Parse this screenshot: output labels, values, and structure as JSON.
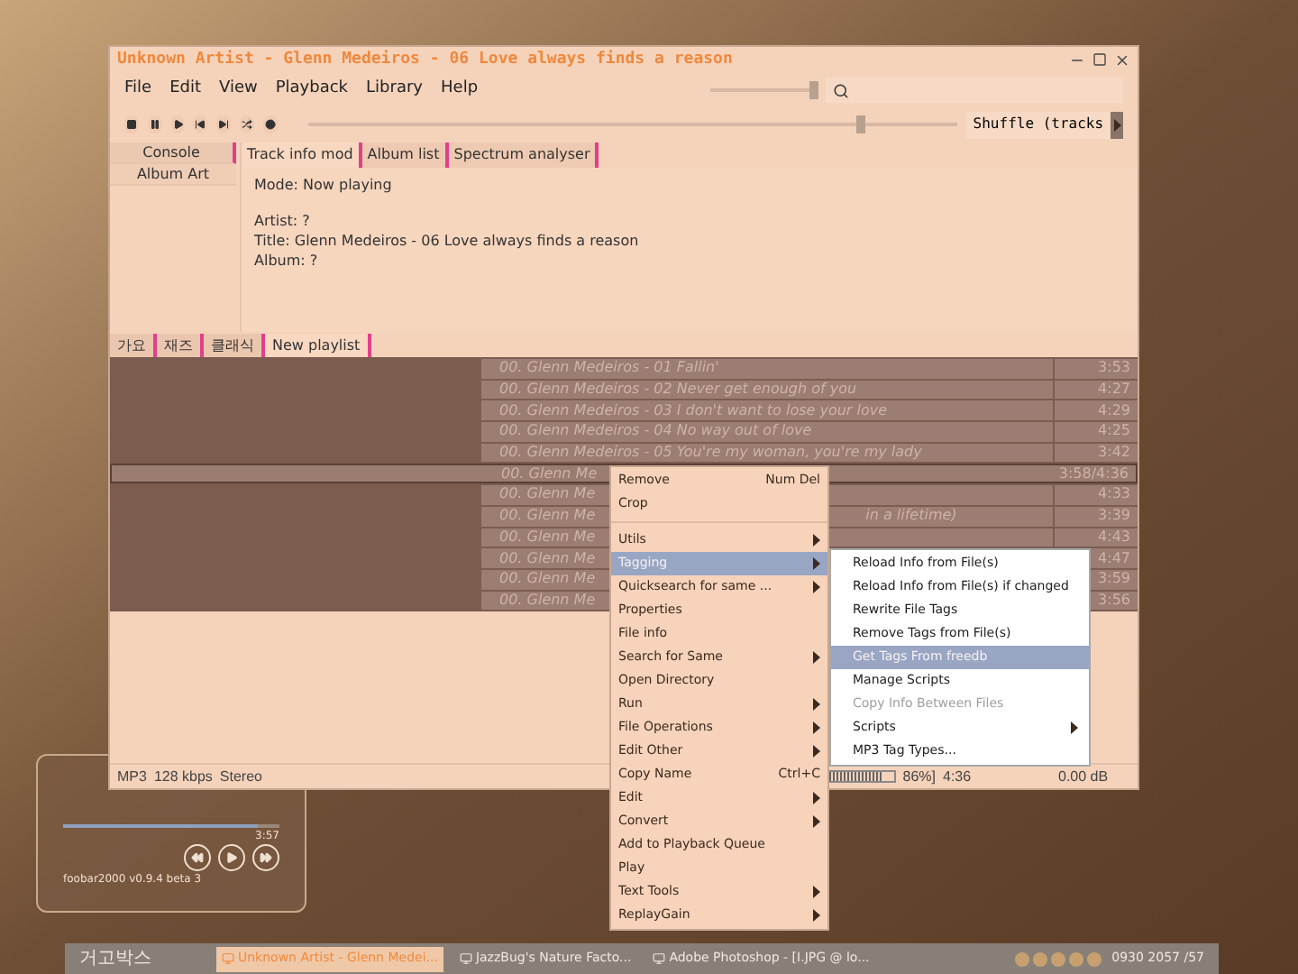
{
  "window": {
    "title": "Unknown Artist - Glenn Medeiros - 06 Love always finds a reason",
    "menu": [
      {
        "label": "File"
      },
      {
        "label": "Edit"
      },
      {
        "label": "View"
      },
      {
        "label": "Playback"
      },
      {
        "label": "Library"
      },
      {
        "label": "Help"
      }
    ],
    "volume": {
      "level": 1
    },
    "seek": {
      "level": 0.86
    },
    "order_dropdown": {
      "value": "Shuffle (tracks"
    },
    "side_tabs": [
      {
        "label": "Console",
        "selected": true
      },
      {
        "label": "Album Art",
        "selected": false
      }
    ],
    "panel_tabs": [
      {
        "label": "Track info mod",
        "selected": true
      },
      {
        "label": "Album list",
        "selected": false
      },
      {
        "label": "Spectrum analyser",
        "selected": false
      }
    ],
    "track_info": [
      [
        "Mode: Now playing"
      ],
      [
        "Artist: ?",
        "Title: Glenn Medeiros - 06 Love always finds a reason",
        "Album: ?"
      ]
    ],
    "playlist_tabs": [
      {
        "label": "가요",
        "selected": false
      },
      {
        "label": "재즈",
        "selected": false
      },
      {
        "label": "클래식",
        "selected": false
      },
      {
        "label": "New playlist",
        "selected": true
      }
    ],
    "tracks": [
      {
        "title": "00. Glenn Medeiros - 01 Fallin'",
        "time": "3:53",
        "playing": false
      },
      {
        "title": "00. Glenn Medeiros - 02 Never get enough of you",
        "time": "4:27",
        "playing": false
      },
      {
        "title": "00. Glenn Medeiros - 03 I don't want to lose your love",
        "time": "4:29",
        "playing": false
      },
      {
        "title": "00. Glenn Medeiros - 04 No way out of love",
        "time": "4:25",
        "playing": false
      },
      {
        "title": "00. Glenn Medeiros - 05 You're my woman, you're my lady",
        "time": "3:42",
        "playing": false
      },
      {
        "title": "00. Glenn Me",
        "time": "3:58/4:36",
        "playing": true
      },
      {
        "title": "00. Glenn Me",
        "time": "4:33",
        "playing": false
      },
      {
        "title": "00. Glenn Me",
        "title_tail": "in a lifetime)",
        "time": "3:39",
        "playing": false
      },
      {
        "title": "00. Glenn Me",
        "time": "4:43",
        "playing": false
      },
      {
        "title": "00. Glenn Me",
        "time": "4:47",
        "playing": false
      },
      {
        "title": "00. Glenn Me",
        "time": "3:59",
        "playing": false
      },
      {
        "title": "00. Glenn Me",
        "time": "3:56",
        "playing": false
      }
    ],
    "status_bar": {
      "format": "MP3",
      "bitrate": "128 kbps",
      "channels": "Stereo",
      "progress_meter": {
        "level": 0.86
      },
      "progress": "86%]",
      "position": "4:36",
      "replaygain": "0.00 dB"
    }
  },
  "context_menu": {
    "items": [
      {
        "kind": "item",
        "label": "Remove",
        "shortcut": "Num Del",
        "submenu": false,
        "selected": false
      },
      {
        "kind": "item",
        "label": "Crop",
        "submenu": false,
        "selected": false
      },
      {
        "kind": "separator"
      },
      {
        "kind": "item",
        "label": "Utils",
        "submenu": true,
        "selected": false
      },
      {
        "kind": "item",
        "label": "Tagging",
        "submenu": true,
        "selected": true
      },
      {
        "kind": "item",
        "label": "Quicksearch for same ...",
        "submenu": true,
        "selected": false
      },
      {
        "kind": "item",
        "label": "Properties",
        "submenu": false,
        "selected": false
      },
      {
        "kind": "item",
        "label": "File info",
        "submenu": false,
        "selected": false
      },
      {
        "kind": "item",
        "label": "Search for Same",
        "submenu": true,
        "selected": false
      },
      {
        "kind": "item",
        "label": "Open Directory",
        "submenu": false,
        "selected": false
      },
      {
        "kind": "item",
        "label": "Run",
        "submenu": true,
        "selected": false
      },
      {
        "kind": "item",
        "label": "File Operations",
        "submenu": true,
        "selected": false
      },
      {
        "kind": "item",
        "label": "Edit Other",
        "submenu": true,
        "selected": false
      },
      {
        "kind": "item",
        "label": "Copy Name",
        "shortcut": "Ctrl+C",
        "submenu": false,
        "selected": false
      },
      {
        "kind": "item",
        "label": "Edit",
        "submenu": true,
        "selected": false
      },
      {
        "kind": "item",
        "label": "Convert",
        "submenu": true,
        "selected": false
      },
      {
        "kind": "item",
        "label": "Add to Playback Queue",
        "submenu": false,
        "selected": false
      },
      {
        "kind": "item",
        "label": "Play",
        "submenu": false,
        "selected": false
      },
      {
        "kind": "item",
        "label": "Text Tools",
        "submenu": true,
        "selected": false
      },
      {
        "kind": "item",
        "label": "ReplayGain",
        "submenu": true,
        "selected": false
      }
    ]
  },
  "submenu": {
    "items": [
      {
        "label": "Reload Info from File(s)",
        "submenu": false,
        "selected": false,
        "disabled": false
      },
      {
        "label": "Reload Info from File(s) if changed",
        "submenu": false,
        "selected": false,
        "disabled": false
      },
      {
        "label": "Rewrite File Tags",
        "submenu": false,
        "selected": false,
        "disabled": false
      },
      {
        "label": "Remove Tags from File(s)",
        "submenu": false,
        "selected": false,
        "disabled": false
      },
      {
        "label": "Get Tags From freedb",
        "submenu": false,
        "selected": true,
        "disabled": false
      },
      {
        "label": "Manage Scripts",
        "submenu": false,
        "selected": false,
        "disabled": false
      },
      {
        "label": "Copy Info Between Files",
        "submenu": false,
        "selected": false,
        "disabled": true
      },
      {
        "label": "Scripts",
        "submenu": true,
        "selected": false,
        "disabled": false
      },
      {
        "label": "MP3 Tag Types...",
        "submenu": false,
        "selected": false,
        "disabled": false
      }
    ]
  },
  "mini_player": {
    "time": "3:57",
    "level": 0.9,
    "version": "foobar2000 v0.9.4 beta 3"
  },
  "taskbar": {
    "start": "거고박스",
    "tasks": [
      {
        "label": "Unknown Artist - Glenn Medei...",
        "selected": true
      },
      {
        "label": "JazzBug's Nature Facto...",
        "selected": false
      },
      {
        "label": "Adobe Photoshop - [I.JPG @ lo...",
        "selected": false
      }
    ],
    "clock": "0930 2057 /57"
  }
}
